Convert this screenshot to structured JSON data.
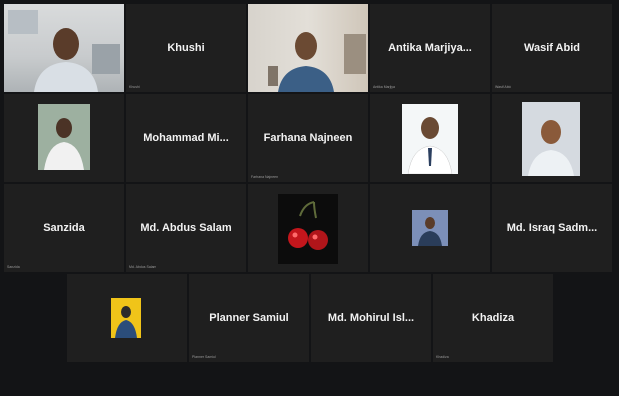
{
  "participants": [
    {
      "name": "",
      "subtitle": "",
      "type": "video",
      "active": true
    },
    {
      "name": "Khushi",
      "subtitle": "Khushi",
      "type": "name"
    },
    {
      "name": "",
      "subtitle": "",
      "type": "video"
    },
    {
      "name": "Antika Marjiya...",
      "subtitle": "Antika Marjiya",
      "type": "name"
    },
    {
      "name": "Wasif Abid",
      "subtitle": "Wasif Abid",
      "type": "name"
    },
    {
      "name": "",
      "subtitle": "",
      "type": "photo"
    },
    {
      "name": "Mohammad Mi...",
      "subtitle": "",
      "type": "name"
    },
    {
      "name": "Farhana Najneen",
      "subtitle": "Farhana Najneen",
      "type": "name"
    },
    {
      "name": "",
      "subtitle": "",
      "type": "photo"
    },
    {
      "name": "",
      "subtitle": "",
      "type": "photo"
    },
    {
      "name": "Sanzida",
      "subtitle": "Sanzida",
      "type": "name"
    },
    {
      "name": "Md. Abdus Salam",
      "subtitle": "Md. Abdus Salam",
      "type": "name"
    },
    {
      "name": "",
      "subtitle": "",
      "type": "photo-cherry"
    },
    {
      "name": "",
      "subtitle": "",
      "type": "photo-small"
    },
    {
      "name": "Md. Israq Sadm...",
      "subtitle": "",
      "type": "name"
    },
    {
      "name": "",
      "subtitle": "",
      "type": "photo-avatar"
    },
    {
      "name": "Planner Samiul",
      "subtitle": "Planner Samiul",
      "type": "name"
    },
    {
      "name": "Md. Mohirul Isl...",
      "subtitle": "",
      "type": "name"
    },
    {
      "name": "Khadiza",
      "subtitle": "Khadiza",
      "type": "name"
    }
  ]
}
